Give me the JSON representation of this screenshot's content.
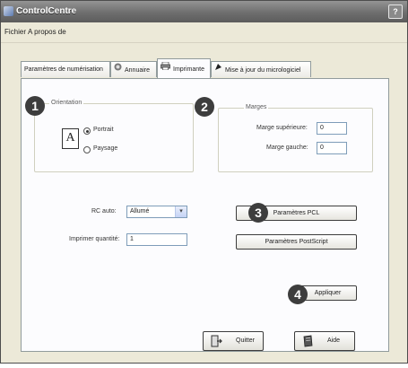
{
  "window": {
    "title": "ControlCentre",
    "help_label": "?"
  },
  "menu": [
    "Fichier",
    "A propos de"
  ],
  "tabs": [
    {
      "label": "Paramètres de numérisation",
      "active": false
    },
    {
      "label": "Annuaire",
      "active": false
    },
    {
      "label": "Imprimante",
      "active": true
    },
    {
      "label": "Mise à jour du micrologiciel",
      "active": false
    }
  ],
  "orientation": {
    "group_label": "Orientation",
    "preview_glyph": "A",
    "options": [
      {
        "label": "Portrait",
        "selected": true
      },
      {
        "label": "Paysage",
        "selected": false
      }
    ]
  },
  "margins": {
    "group_label": "Marges",
    "top_label": "Marge supérieure:",
    "top_value": "0",
    "left_label": "Marge gauche:",
    "left_value": "0"
  },
  "fields": {
    "rc_auto_label": "RC auto:",
    "rc_auto_value": "Allumé",
    "quantity_label": "Imprimer quantité:",
    "quantity_value": "1"
  },
  "buttons": {
    "pcl": "Paramètres PCL",
    "postscript": "Paramètres PostScript",
    "apply": "Appliquer",
    "quit": "Quitter",
    "help": "Aide"
  },
  "badges": [
    "1",
    "2",
    "3",
    "4"
  ],
  "colors": {
    "titlebar": "#6e6e6e",
    "badge": "#3d3d3d",
    "input_border": "#7f9db9"
  }
}
